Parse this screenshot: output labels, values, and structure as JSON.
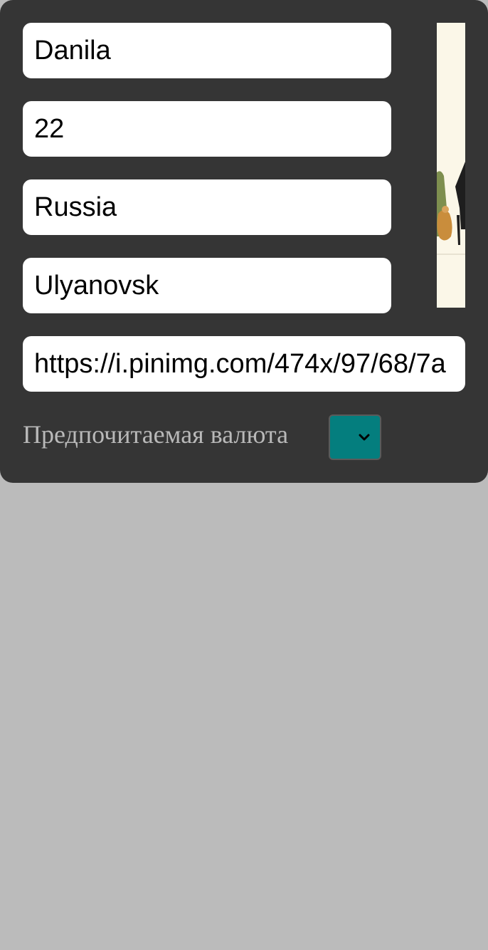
{
  "profile": {
    "name": "Danila",
    "age": "22",
    "country": "Russia",
    "city": "Ulyanovsk",
    "avatar_url": "https://i.pinimg.com/474x/97/68/7a"
  },
  "currency": {
    "label": "Предпочитаемая валюта",
    "selected": ""
  },
  "colors": {
    "page_background": "#bbbbbb",
    "card_background": "#353535",
    "select_background": "#047e7e",
    "label_text": "#b9b9b9"
  },
  "icons": {
    "select_arrow": "chevron-down-icon",
    "avatar": "avatar-image"
  }
}
